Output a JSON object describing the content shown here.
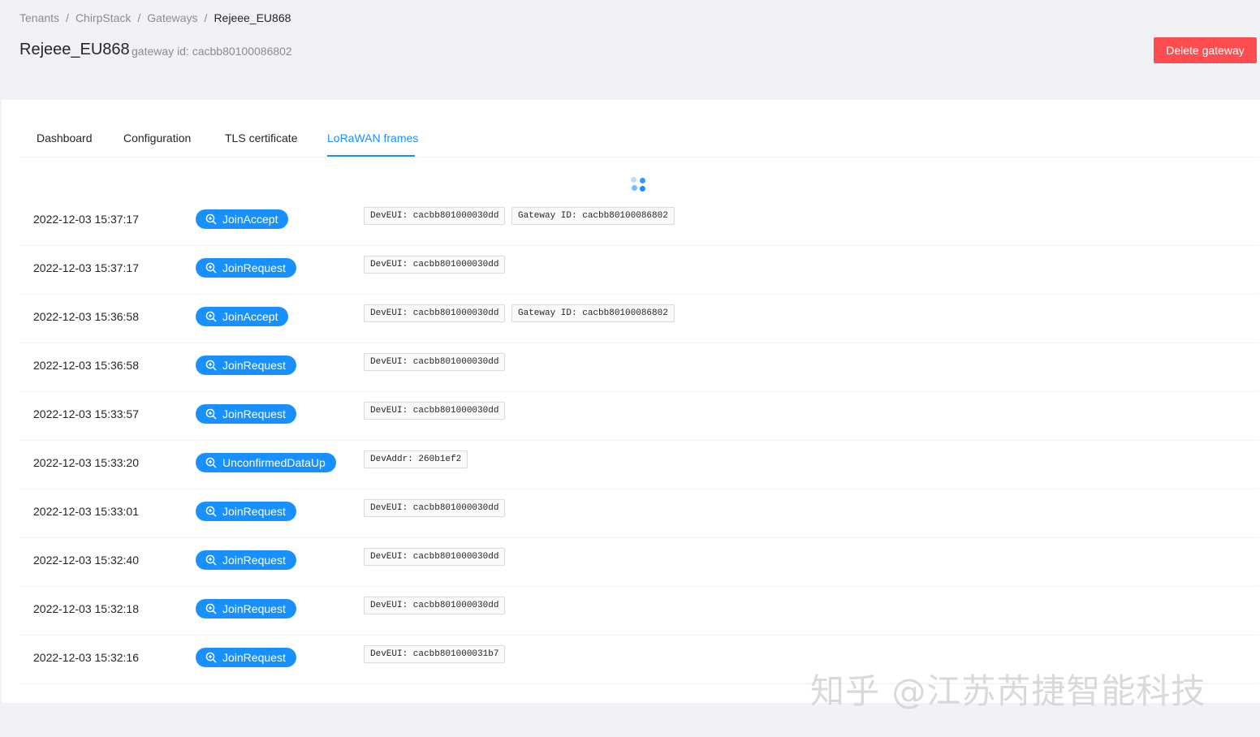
{
  "breadcrumb": [
    "Tenants",
    "ChirpStack",
    "Gateways",
    "Rejeee_EU868"
  ],
  "header": {
    "title": "Rejeee_EU868",
    "gateway_id": "gateway id: cacbb80100086802",
    "delete_label": "Delete gateway"
  },
  "tabs": [
    {
      "label": "Dashboard",
      "active": false
    },
    {
      "label": "Configuration",
      "active": false
    },
    {
      "label": "TLS certificate",
      "active": false
    },
    {
      "label": "LoRaWAN frames",
      "active": true
    }
  ],
  "frames": [
    {
      "time": "2022-12-03 15:37:17",
      "type": "JoinAccept",
      "tags": [
        "DevEUI: cacbb801000030dd",
        "Gateway ID: cacbb80100086802"
      ]
    },
    {
      "time": "2022-12-03 15:37:17",
      "type": "JoinRequest",
      "tags": [
        "DevEUI: cacbb801000030dd"
      ]
    },
    {
      "time": "2022-12-03 15:36:58",
      "type": "JoinAccept",
      "tags": [
        "DevEUI: cacbb801000030dd",
        "Gateway ID: cacbb80100086802"
      ]
    },
    {
      "time": "2022-12-03 15:36:58",
      "type": "JoinRequest",
      "tags": [
        "DevEUI: cacbb801000030dd"
      ]
    },
    {
      "time": "2022-12-03 15:33:57",
      "type": "JoinRequest",
      "tags": [
        "DevEUI: cacbb801000030dd"
      ]
    },
    {
      "time": "2022-12-03 15:33:20",
      "type": "UnconfirmedDataUp",
      "tags": [
        "DevAddr: 260b1ef2"
      ]
    },
    {
      "time": "2022-12-03 15:33:01",
      "type": "JoinRequest",
      "tags": [
        "DevEUI: cacbb801000030dd"
      ]
    },
    {
      "time": "2022-12-03 15:32:40",
      "type": "JoinRequest",
      "tags": [
        "DevEUI: cacbb801000030dd"
      ]
    },
    {
      "time": "2022-12-03 15:32:18",
      "type": "JoinRequest",
      "tags": [
        "DevEUI: cacbb801000030dd"
      ]
    },
    {
      "time": "2022-12-03 15:32:16",
      "type": "JoinRequest",
      "tags": [
        "DevEUI: cacbb801000031b7"
      ]
    }
  ],
  "watermark": "知乎 @江苏芮捷智能科技",
  "colors": {
    "primary": "#1890ff",
    "danger": "#ff4d4f",
    "background": "#f0f2f5"
  },
  "icons": {
    "frame_button": "zoom-in-icon",
    "loading": "loading-spinner-icon"
  }
}
